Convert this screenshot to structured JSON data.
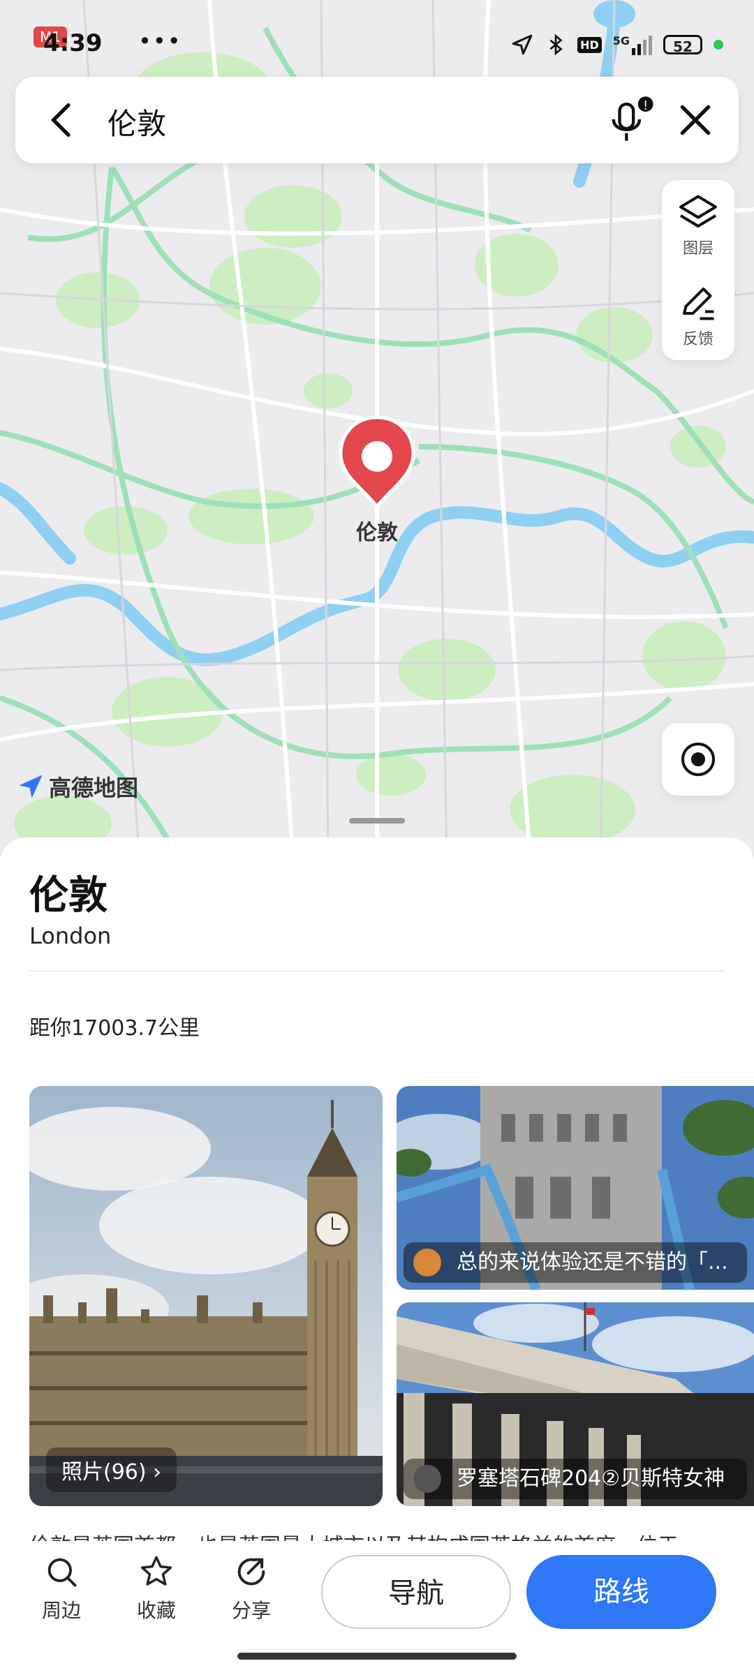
{
  "status_bar": {
    "time": "4:39",
    "badge": "M1",
    "more": "•••",
    "network": "5G",
    "hd": "HD",
    "battery": "52"
  },
  "search": {
    "query": "伦敦"
  },
  "map_tools": {
    "layers_label": "图层",
    "feedback_label": "反馈"
  },
  "map": {
    "pin_label": "伦敦",
    "logo_text": "高德地图",
    "colors": {
      "water": "#8fd0f2",
      "park": "#cdeec1",
      "road_major": "#9de0b8",
      "pin": "#e3474d"
    }
  },
  "place": {
    "name": "伦敦",
    "name_en": "London",
    "distance": "距你17003.7公里",
    "photos_label": "照片(96) ›",
    "review_1": "总的来说体验还是不错的「...",
    "review_2": "罗塞塔石碑204②贝斯特女神",
    "description": "伦敦是英国首都，也是英国最大城市以及其构成国英格兰的首府，位于"
  },
  "bottom_bar": {
    "nearby": "周边",
    "favorite": "收藏",
    "share": "分享",
    "navigate": "导航",
    "route": "路线"
  },
  "colors": {
    "accent": "#2e77f7"
  }
}
